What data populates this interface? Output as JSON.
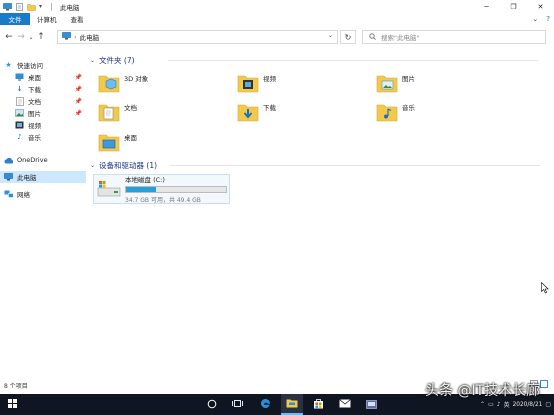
{
  "window": {
    "title": "此电脑",
    "minimize_icon": "minimize-icon",
    "maximize_icon": "maximize-icon",
    "close_icon": "close-icon"
  },
  "ribbon": {
    "tabs": [
      {
        "label": "文件",
        "active": true
      },
      {
        "label": "计算机",
        "active": false
      },
      {
        "label": "查看",
        "active": false
      }
    ],
    "help": "?"
  },
  "addressbar": {
    "path": "此电脑",
    "search_placeholder": "搜索\"此电脑\""
  },
  "sidebar": {
    "items": [
      {
        "label": "快速访问",
        "icon": "star-icon",
        "pinned": false
      },
      {
        "label": "桌面",
        "icon": "desktop-icon",
        "pinned": true
      },
      {
        "label": "下载",
        "icon": "download-icon",
        "pinned": true
      },
      {
        "label": "文档",
        "icon": "document-icon",
        "pinned": true
      },
      {
        "label": "图片",
        "icon": "picture-icon",
        "pinned": true
      },
      {
        "label": "视频",
        "icon": "video-icon",
        "pinned": false
      },
      {
        "label": "音乐",
        "icon": "music-icon",
        "pinned": false
      },
      {
        "label": "OneDrive",
        "icon": "cloud-icon",
        "pinned": false
      },
      {
        "label": "此电脑",
        "icon": "computer-icon",
        "pinned": false,
        "selected": true
      },
      {
        "label": "网络",
        "icon": "network-icon",
        "pinned": false
      }
    ]
  },
  "folders_group": {
    "header": "文件夹 (7)",
    "items": [
      {
        "label": "3D 对象",
        "icon": "3d-objects-icon"
      },
      {
        "label": "视频",
        "icon": "video-folder-icon"
      },
      {
        "label": "图片",
        "icon": "pictures-folder-icon"
      },
      {
        "label": "文档",
        "icon": "documents-folder-icon"
      },
      {
        "label": "下载",
        "icon": "downloads-folder-icon"
      },
      {
        "label": "音乐",
        "icon": "music-folder-icon"
      },
      {
        "label": "桌面",
        "icon": "desktop-folder-icon"
      }
    ]
  },
  "devices_group": {
    "header": "设备和驱动器 (1)",
    "drive": {
      "name": "本地磁盘 (C:)",
      "free_text": "34.7 GB 可用，共 49.4 GB",
      "used_fraction": 0.3
    }
  },
  "statusbar": {
    "count": "8 个项目"
  },
  "taskbar": {
    "tray_lang": "英",
    "date": "2020/8/21",
    "watermark": "头条 @IT技术长廊"
  },
  "colors": {
    "accent": "#1979ca",
    "header_blue": "#1e3287",
    "drive_fill": "#26a0da",
    "taskbar": "#101621"
  }
}
